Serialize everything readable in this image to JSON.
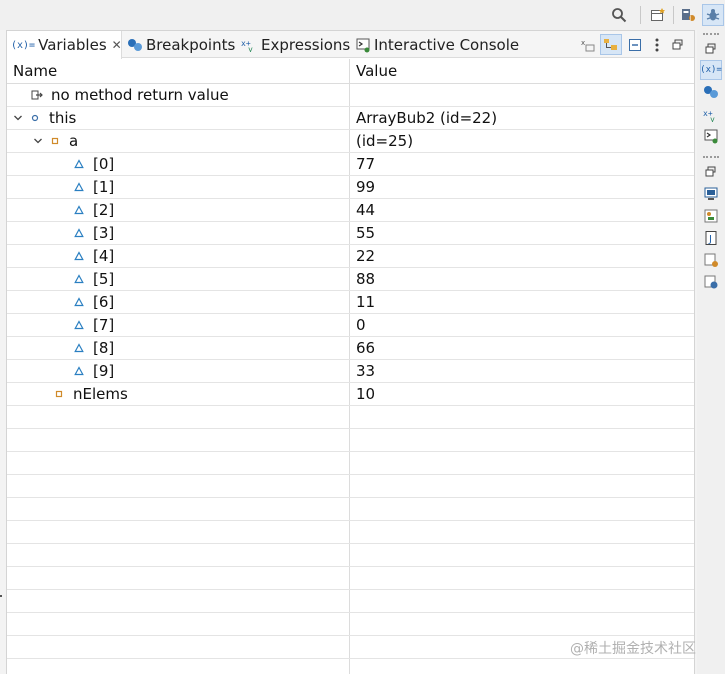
{
  "tabs": [
    {
      "label": "Variables",
      "icon": "variables-icon",
      "active": true
    },
    {
      "label": "Breakpoints",
      "icon": "breakpoints-icon",
      "active": false
    },
    {
      "label": "Expressions",
      "icon": "expressions-icon",
      "active": false
    },
    {
      "label": "Interactive Console",
      "icon": "console-icon",
      "active": false
    }
  ],
  "columns": {
    "name": "Name",
    "value": "Value"
  },
  "rows": [
    {
      "name": "no method return value",
      "value": ""
    },
    {
      "name": "this",
      "value": "ArrayBub2  (id=22)"
    },
    {
      "name": "a",
      "value": "(id=25)"
    },
    {
      "name": "[0]",
      "value": "77"
    },
    {
      "name": "[1]",
      "value": "99"
    },
    {
      "name": "[2]",
      "value": "44"
    },
    {
      "name": "[3]",
      "value": "55"
    },
    {
      "name": "[4]",
      "value": "22"
    },
    {
      "name": "[5]",
      "value": "88"
    },
    {
      "name": "[6]",
      "value": "11"
    },
    {
      "name": "[7]",
      "value": "0"
    },
    {
      "name": "[8]",
      "value": "66"
    },
    {
      "name": "[9]",
      "value": "33"
    },
    {
      "name": "nElems",
      "value": "10"
    }
  ],
  "watermark": "@稀土掘金技术社区",
  "colors": {
    "accent": "#1f5fa8",
    "selection": "#d7e6f6",
    "field": "#d08a2a",
    "element": "#2a7fc1"
  }
}
